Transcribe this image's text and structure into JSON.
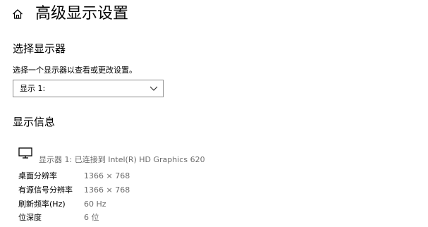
{
  "header": {
    "home_icon": "home-icon",
    "title": "高级显示设置"
  },
  "select_display": {
    "title": "选择显示器",
    "description": "选择一个显示器以查看或更改设置。",
    "selected_value": "显示 1:",
    "chevron_icon": "chevron-down-icon"
  },
  "display_info": {
    "title": "显示信息",
    "monitor_icon": "monitor-icon",
    "monitor_description": "显示器 1: 已连接到 Intel(R) HD Graphics 620",
    "rows": [
      {
        "label": "桌面分辨率",
        "value": "1366 × 768"
      },
      {
        "label": "有源信号分辨率",
        "value": "1366 × 768"
      },
      {
        "label": "刷新频率(Hz)",
        "value": "60 Hz"
      },
      {
        "label": "位深度",
        "value": "6 位"
      }
    ]
  }
}
